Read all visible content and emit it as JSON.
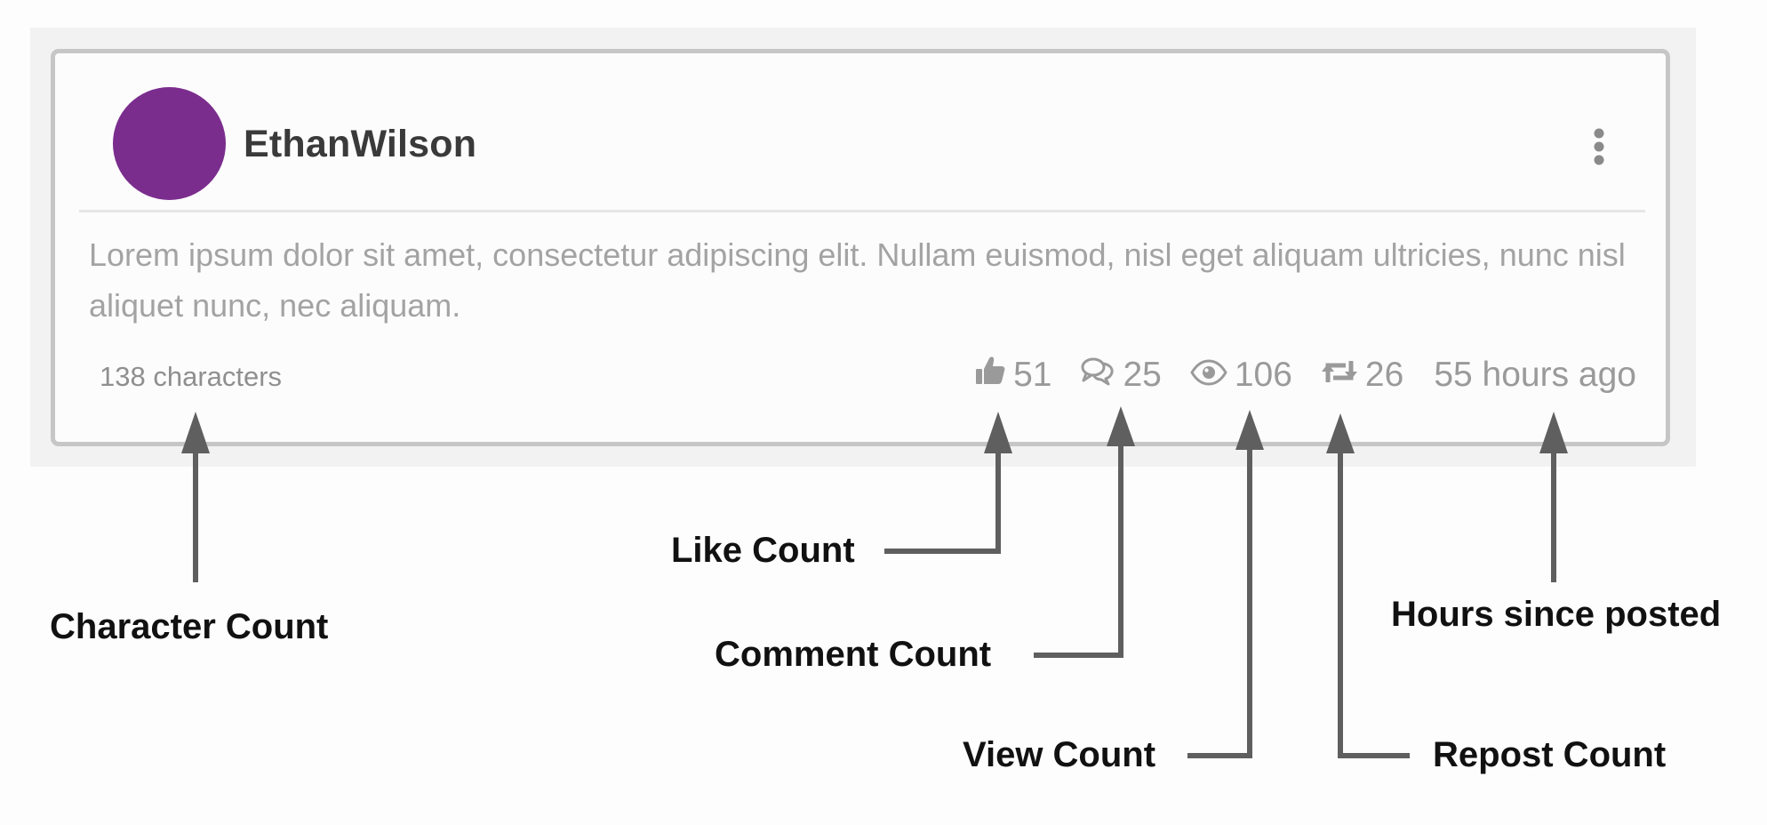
{
  "post": {
    "username": "EthanWilson",
    "avatar_color": "#7b2d8e",
    "body": "Lorem ipsum dolor sit amet, consectetur adipiscing elit. Nullam euismod, nisl eget aliquam ultricies, nunc nisl aliquet nunc, nec aliquam.",
    "char_count": "138 characters",
    "likes": "51",
    "comments": "25",
    "views": "106",
    "reposts": "26",
    "time_ago": "55 hours ago",
    "icons": {
      "more": "more-vertical-icon",
      "like": "thumbs-up-icon",
      "comment": "comment-icon",
      "view": "eye-icon",
      "repost": "repost-icon"
    }
  },
  "annotations": {
    "character_count": "Character Count",
    "like_count": "Like Count",
    "comment_count": "Comment Count",
    "view_count": "View Count",
    "repost_count": "Repost Count",
    "hours_since_posted": "Hours since posted"
  }
}
